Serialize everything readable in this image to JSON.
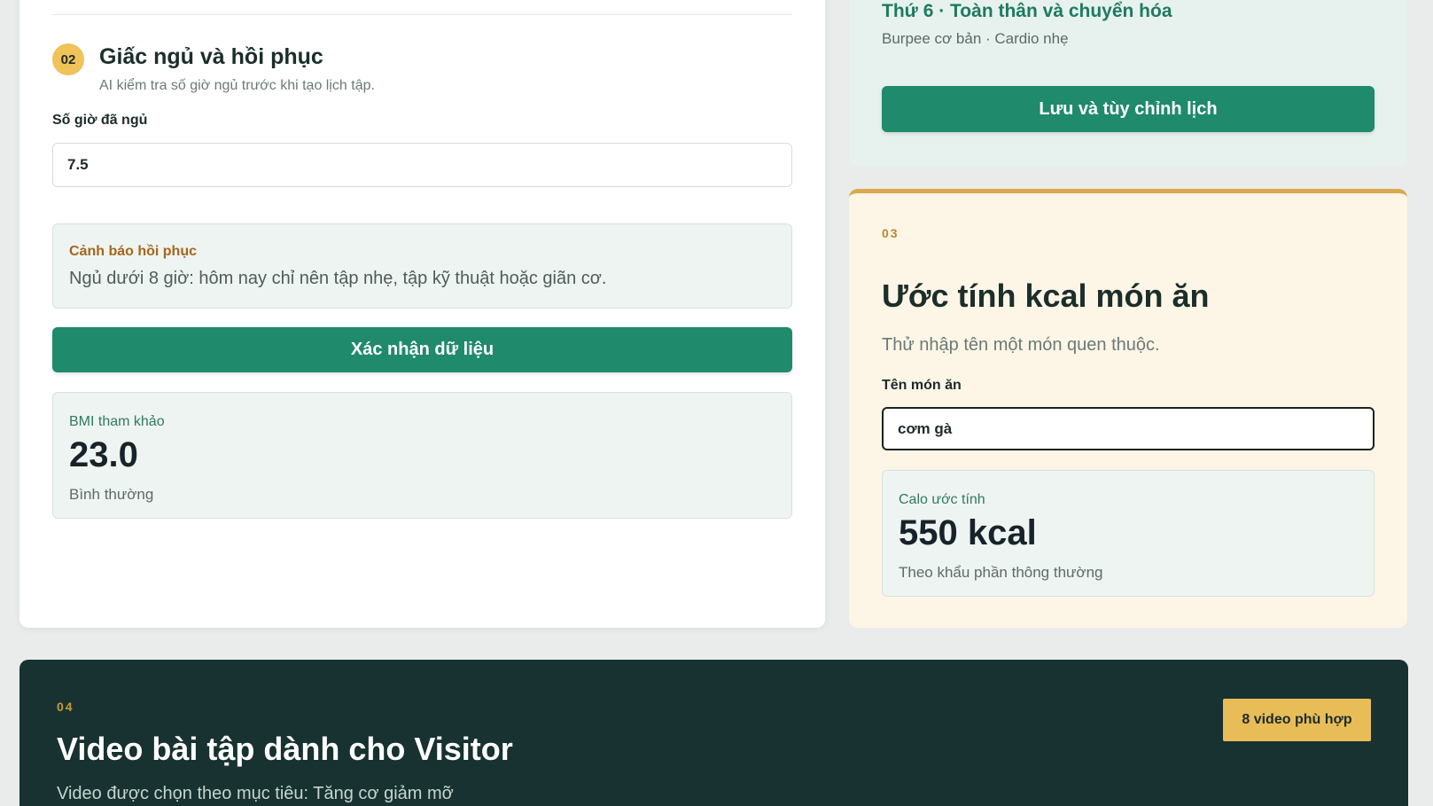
{
  "sleep_section": {
    "step_number": "02",
    "title": "Giấc ngủ và hồi phục",
    "subtitle": "AI kiểm tra số giờ ngủ trước khi tạo lịch tập.",
    "hours_label": "Số giờ đã ngủ",
    "hours_value": "7.5",
    "warning": {
      "title": "Cảnh báo hồi phục",
      "text": "Ngủ dưới 8 giờ: hôm nay chỉ nên tập nhẹ, tập kỹ thuật hoặc giãn cơ."
    },
    "confirm_button": "Xác nhận dữ liệu",
    "bmi": {
      "label": "BMI tham khảo",
      "value": "23.0",
      "note": "Bình thường"
    }
  },
  "schedule_card": {
    "day_title": "Thứ 6 · Toàn thân và chuyển hóa",
    "day_exercises": "Burpee cơ bản · Cardio nhẹ",
    "save_button": "Lưu và tùy chỉnh lịch"
  },
  "kcal_section": {
    "number": "03",
    "title": "Ước tính kcal món ăn",
    "subtitle": "Thử nhập tên một món quen thuộc.",
    "dish_label": "Tên món ăn",
    "dish_value": "cơm gà",
    "result": {
      "label": "Calo ước tính",
      "value": "550 kcal",
      "note": "Theo khẩu phần thông thường"
    }
  },
  "video_section": {
    "number": "04",
    "title": "Video bài tập dành cho Visitor",
    "subtitle": "Video được chọn theo mục tiêu: Tăng cơ giảm mỡ",
    "count_badge": "8 video phù hợp"
  },
  "colors": {
    "primary_green": "#1f8a6c",
    "accent_gold": "#efc25a",
    "dark_panel": "#173230",
    "warning_text": "#a4661b"
  }
}
